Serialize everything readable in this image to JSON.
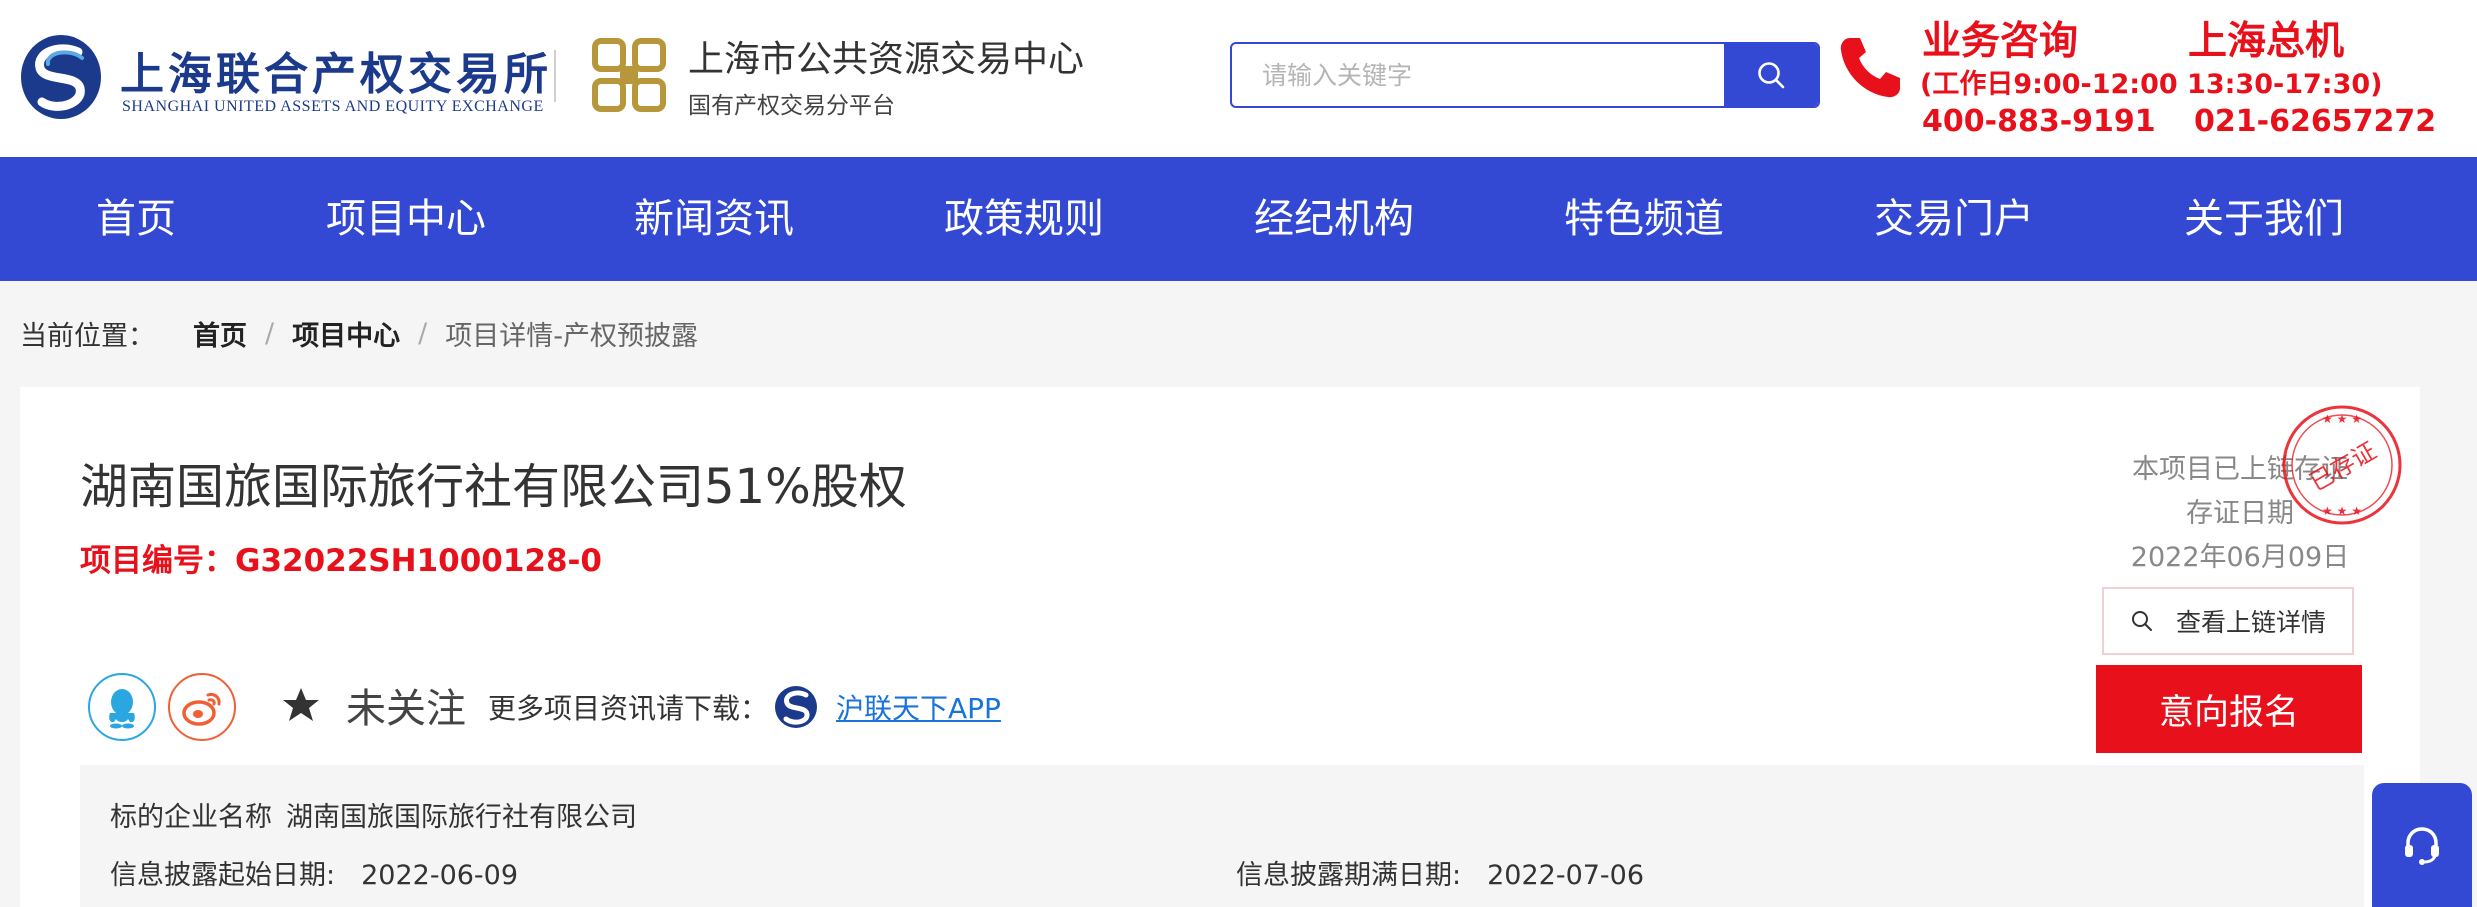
{
  "header": {
    "sue_name_cn": "上海联合产权交易所",
    "sue_name_en": "SHANGHAI UNITED ASSETS AND EQUITY EXCHANGE",
    "platform_name": "上海市公共资源交易中心",
    "platform_sub": "国有产权交易分平台",
    "search": {
      "placeholder": "请输入关键字",
      "value": ""
    },
    "contact": {
      "consult_title": "业务咨询",
      "hq_title": "上海总机",
      "hours": "(工作日9:00-12:00 13:30-17:30)",
      "consult_phone": "400-883-9191",
      "hq_phone": "021-62657272"
    },
    "brand_color": "#3349d3",
    "accent_color": "#e8101a"
  },
  "nav": {
    "items": [
      "首页",
      "项目中心",
      "新闻资讯",
      "政策规则",
      "经纪机构",
      "特色频道",
      "交易门户",
      "关于我们"
    ]
  },
  "breadcrumb": {
    "prefix": "当前位置：",
    "home": "首页",
    "section": "项目中心",
    "separator": "/",
    "current": "项目详情-产权预披露"
  },
  "project": {
    "title": "湖南国旅国际旅行社有限公司51%股权",
    "code_label": "项目编号：",
    "code": "G32022SH1000128-0",
    "chain_status": "本项目已上链存证",
    "chain_date_label": "存证日期",
    "chain_date": "2022年06月09日",
    "stamp_text": "已存证",
    "chain_btn": "查看上链详情",
    "follow_label": "未关注",
    "more_text": "更多项目资讯请下载：",
    "app_link": "沪联天下APP",
    "signup_btn": "意向报名"
  },
  "info": {
    "company_label": "标的企业名称",
    "company_value": "湖南国旅国际旅行社有限公司",
    "start_label": "信息披露起始日期:",
    "start_value": "2022-06-09",
    "end_label": "信息披露期满日期:",
    "end_value": "2022-07-06"
  },
  "icons": [
    "search-icon",
    "phone-icon",
    "search-icon",
    "qq-icon",
    "weibo-icon",
    "star-icon",
    "app-logo-icon",
    "headset-icon"
  ]
}
